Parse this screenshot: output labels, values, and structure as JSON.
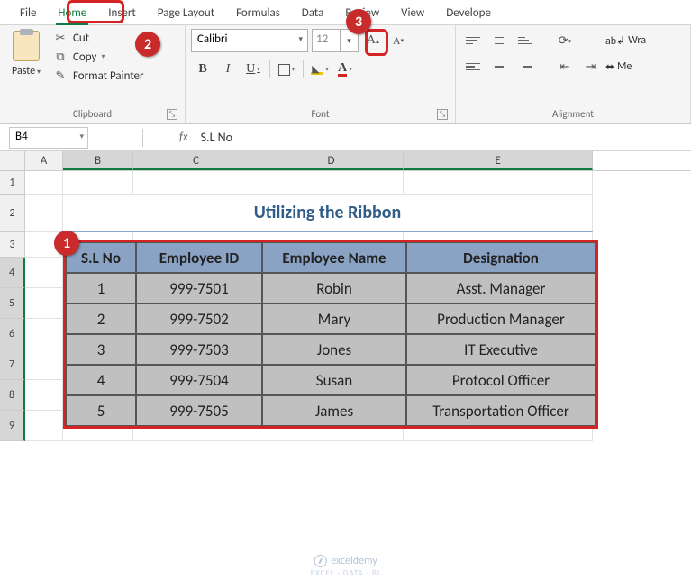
{
  "tabs": [
    "File",
    "Home",
    "Insert",
    "Page Layout",
    "Formulas",
    "Data",
    "Review",
    "View",
    "Develope"
  ],
  "active_tab": "Home",
  "callouts": {
    "c1": "1",
    "c2": "2",
    "c3": "3"
  },
  "clipboard": {
    "paste": "Paste",
    "cut": "Cut",
    "copy": "Copy",
    "format_painter": "Format Painter",
    "label": "Clipboard"
  },
  "font": {
    "name": "Calibri",
    "size": "12",
    "bold": "B",
    "italic": "I",
    "underline": "U",
    "label": "Font"
  },
  "alignment": {
    "wrap": "Wra",
    "merge": "Me",
    "label": "Alignment"
  },
  "namebox": "B4",
  "formula": "S.L No",
  "cols": {
    "A": "A",
    "B": "B",
    "C": "C",
    "D": "D",
    "E": "E"
  },
  "rownums": [
    "1",
    "2",
    "3",
    "4",
    "5",
    "6",
    "7",
    "8",
    "9"
  ],
  "sheet_title": "Utilizing the Ribbon",
  "headers": {
    "b": "S.L No",
    "c": "Employee ID",
    "d": "Employee Name",
    "e": "Designation"
  },
  "data": [
    {
      "b": "1",
      "c": "999-7501",
      "d": "Robin",
      "e": "Asst. Manager"
    },
    {
      "b": "2",
      "c": "999-7502",
      "d": "Mary",
      "e": "Production Manager"
    },
    {
      "b": "3",
      "c": "999-7503",
      "d": "Jones",
      "e": "IT Executive"
    },
    {
      "b": "4",
      "c": "999-7504",
      "d": "Susan",
      "e": "Protocol Officer"
    },
    {
      "b": "5",
      "c": "999-7505",
      "d": "James",
      "e": "Transportation Officer"
    }
  ],
  "watermark": "exceldemy",
  "watermark_sub": "EXCEL · DATA · BI"
}
